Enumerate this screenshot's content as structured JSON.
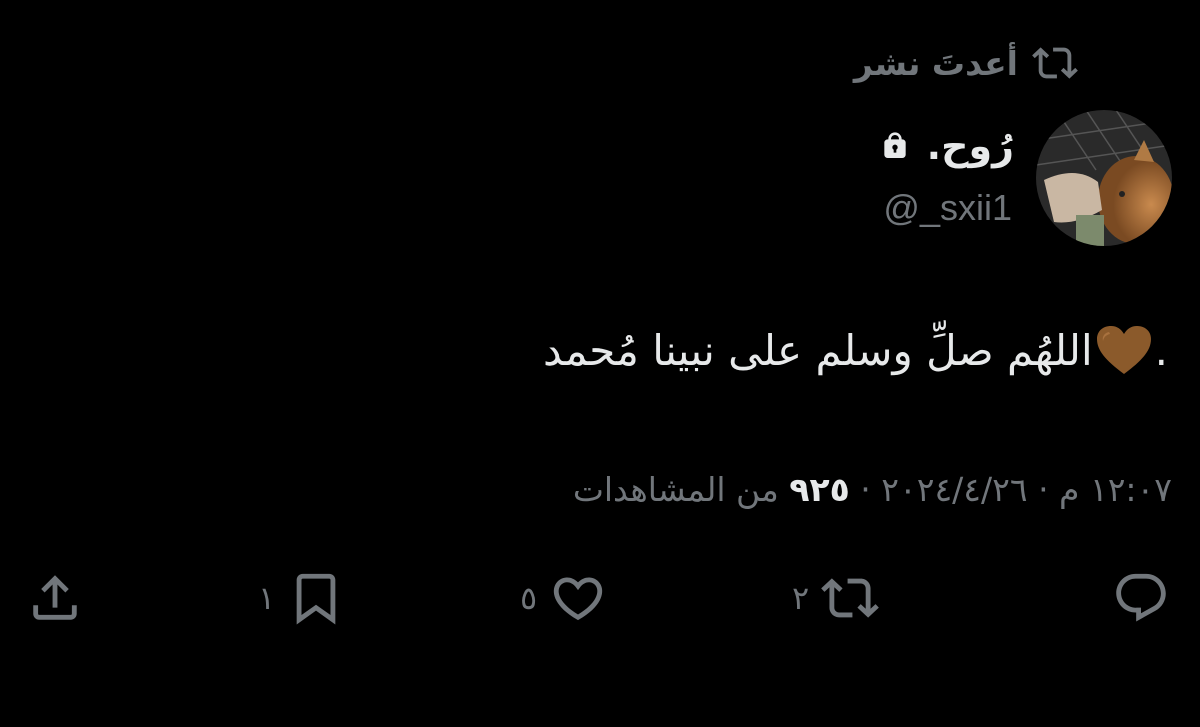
{
  "repost": {
    "label": "أعدتَ نشر",
    "icon": "repost-icon"
  },
  "author": {
    "display_name": "رُوح.",
    "handle": "@_sxii1",
    "protected_icon": "lock-icon",
    "avatar_icon": "avatar-photo"
  },
  "tweet": {
    "text": "اللهُم صلِّ وسلم على نبينا مُحمد",
    "emoji": "brown-heart",
    "tail": ".",
    "emoji_color": "#8B5A2B"
  },
  "meta": {
    "timestamp": "١٢:٠٧ م · ٢٠٢٤/٤/٢٦ · ",
    "views_count": "٩٢٥",
    "views_label": " من المشاهدات"
  },
  "actions": {
    "reply": {
      "icon": "reply-icon",
      "count": ""
    },
    "repost": {
      "icon": "repost-icon",
      "count": "٢"
    },
    "like": {
      "icon": "heart-icon",
      "count": "٥"
    },
    "bookmark": {
      "icon": "bookmark-icon",
      "count": "١"
    },
    "share": {
      "icon": "share-icon",
      "count": ""
    }
  },
  "colors": {
    "background": "#000000",
    "text_primary": "#e7e9ea",
    "text_secondary": "#71767b"
  }
}
